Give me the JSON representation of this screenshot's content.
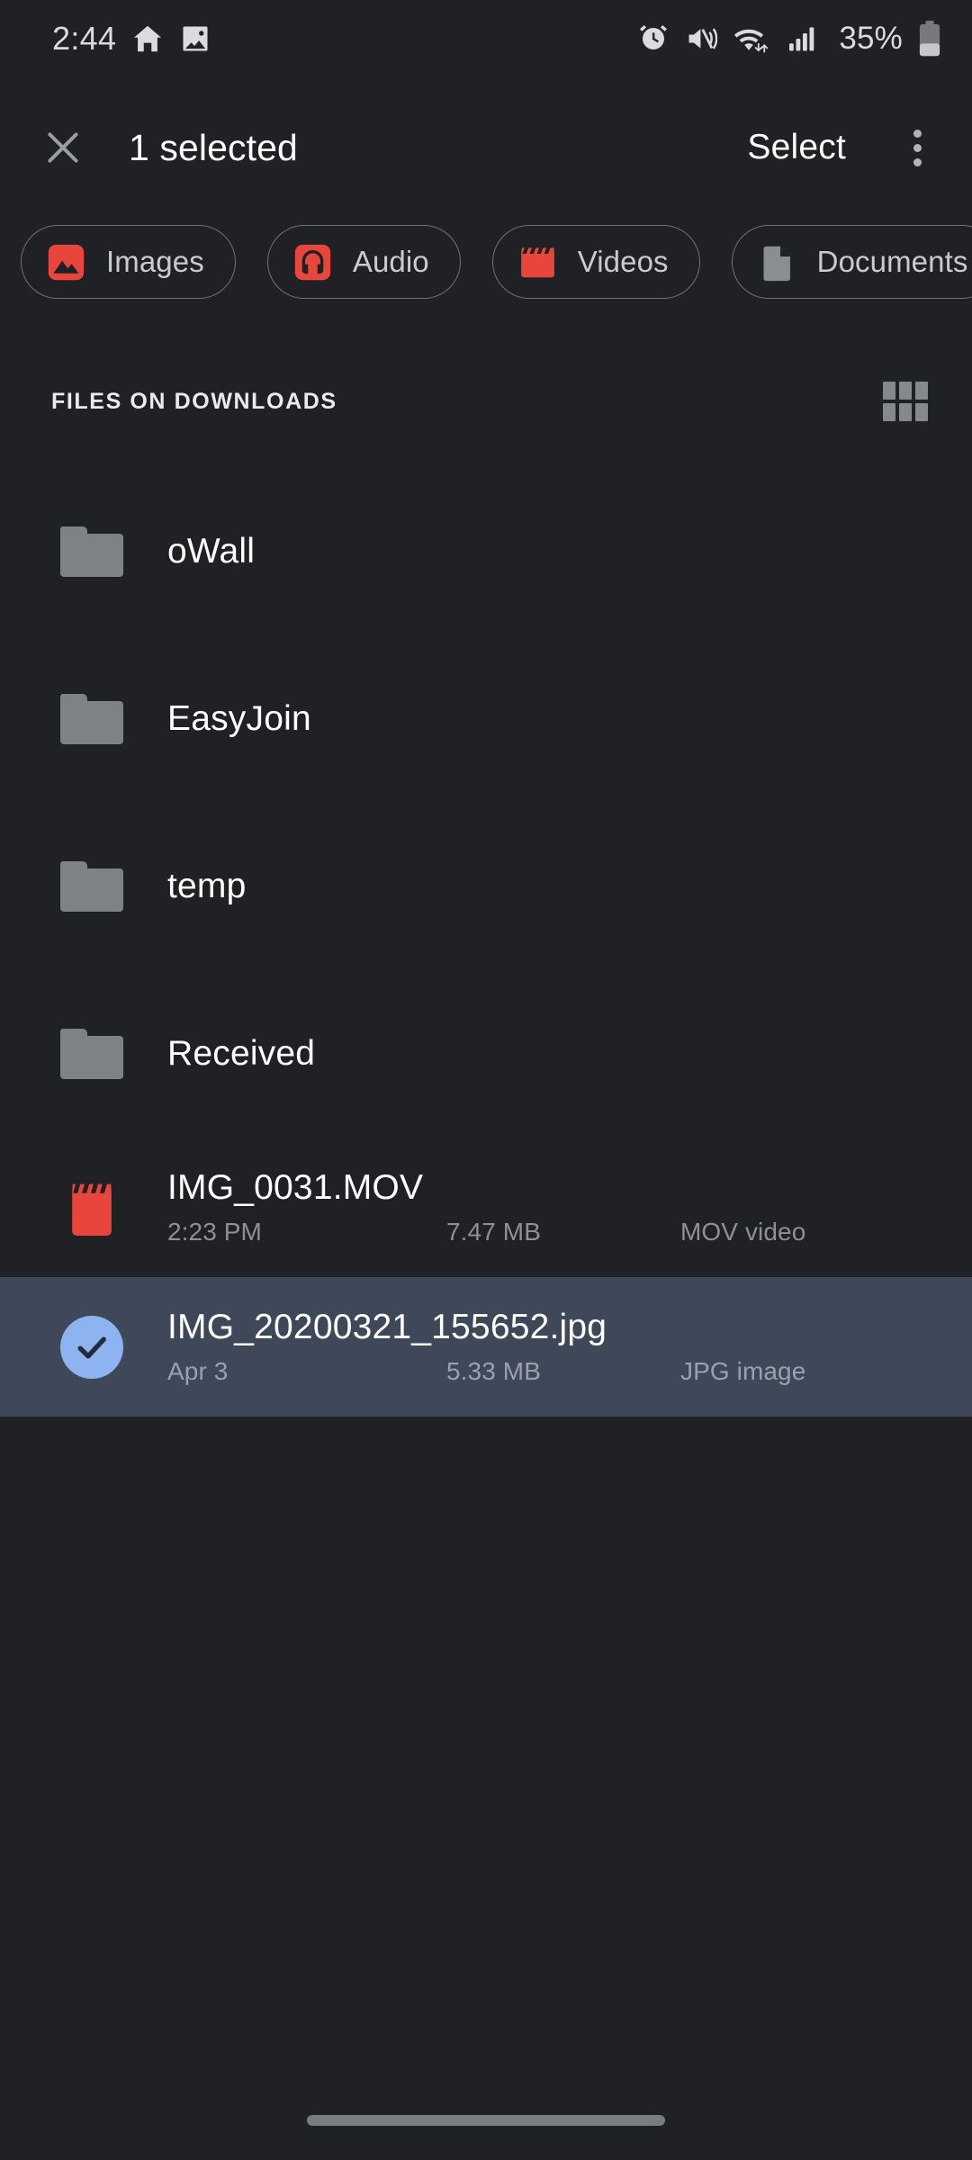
{
  "status_bar": {
    "time": "2:44",
    "battery_percent": "35%",
    "left_icons": [
      "home-icon",
      "image-icon"
    ],
    "right_icons": [
      "alarm-icon",
      "mute-vibrate-icon",
      "wifi-icon",
      "signal-icon",
      "battery-icon"
    ]
  },
  "app_bar": {
    "close_icon": "close-icon",
    "title": "1 selected",
    "select_label": "Select",
    "overflow_icon": "more-vert-icon"
  },
  "chips": [
    {
      "label": "Images",
      "icon": "image-icon",
      "color": "#e8453c"
    },
    {
      "label": "Audio",
      "icon": "headphones-icon",
      "color": "#e8453c"
    },
    {
      "label": "Videos",
      "icon": "clapperboard-icon",
      "color": "#e8453c"
    },
    {
      "label": "Documents",
      "icon": "document-icon",
      "color": "#8a8d91"
    }
  ],
  "section": {
    "title": "FILES ON DOWNLOADS",
    "view_toggle_icon": "grid-view-icon"
  },
  "files": [
    {
      "name": "oWall",
      "type_icon": "folder-icon",
      "date": "",
      "size": "",
      "kind": "",
      "selected": false
    },
    {
      "name": "EasyJoin",
      "type_icon": "folder-icon",
      "date": "",
      "size": "",
      "kind": "",
      "selected": false
    },
    {
      "name": "temp",
      "type_icon": "folder-icon",
      "date": "",
      "size": "",
      "kind": "",
      "selected": false
    },
    {
      "name": "Received",
      "type_icon": "folder-icon",
      "date": "",
      "size": "",
      "kind": "",
      "selected": false
    },
    {
      "name": "IMG_0031.MOV",
      "type_icon": "clapperboard-icon",
      "date": "2:23 PM",
      "size": "7.47 MB",
      "kind": "MOV video",
      "selected": false
    },
    {
      "name": "IMG_20200321_155652.jpg",
      "type_icon": "check-circle-icon",
      "date": "Apr 3",
      "size": "5.33 MB",
      "kind": "JPG image",
      "selected": true
    }
  ],
  "colors": {
    "background": "#1f2125",
    "selected_row": "#3e4859",
    "accent_red": "#e8453c",
    "check_blue": "#8db3f0",
    "folder_gray": "#7e8185",
    "secondary_text": "#8d9094"
  },
  "gesture_bar": "home-gesture-bar"
}
